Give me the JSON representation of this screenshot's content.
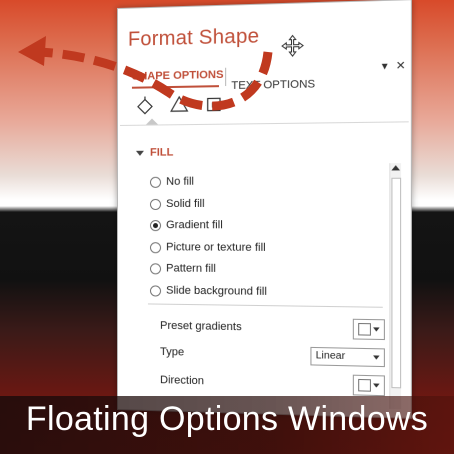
{
  "panel": {
    "title": "Format Shape",
    "dropdown_glyph": "▾",
    "close_glyph": "✕",
    "tabs": {
      "shape_options": "SHAPE OPTIONS",
      "text_options": "TEXT OPTIONS"
    },
    "icons": [
      "fill-line-icon",
      "effects-icon",
      "size-properties-icon"
    ],
    "section": "FILL",
    "fill_options": [
      {
        "label": "No fill",
        "selected": false
      },
      {
        "label": "Solid fill",
        "selected": false
      },
      {
        "label": "Gradient fill",
        "selected": true
      },
      {
        "label": "Picture or texture fill",
        "selected": false
      },
      {
        "label": "Pattern fill",
        "selected": false
      },
      {
        "label": "Slide background fill",
        "selected": false
      }
    ],
    "preset_gradients_label": "Preset gradients",
    "type_label": "Type",
    "type_value": "Linear",
    "direction_label": "Direction"
  },
  "caption": "Floating Options Windows",
  "colors": {
    "accent": "#c0503a",
    "arrow": "#c0391f",
    "caption_text": "#ffffff"
  }
}
